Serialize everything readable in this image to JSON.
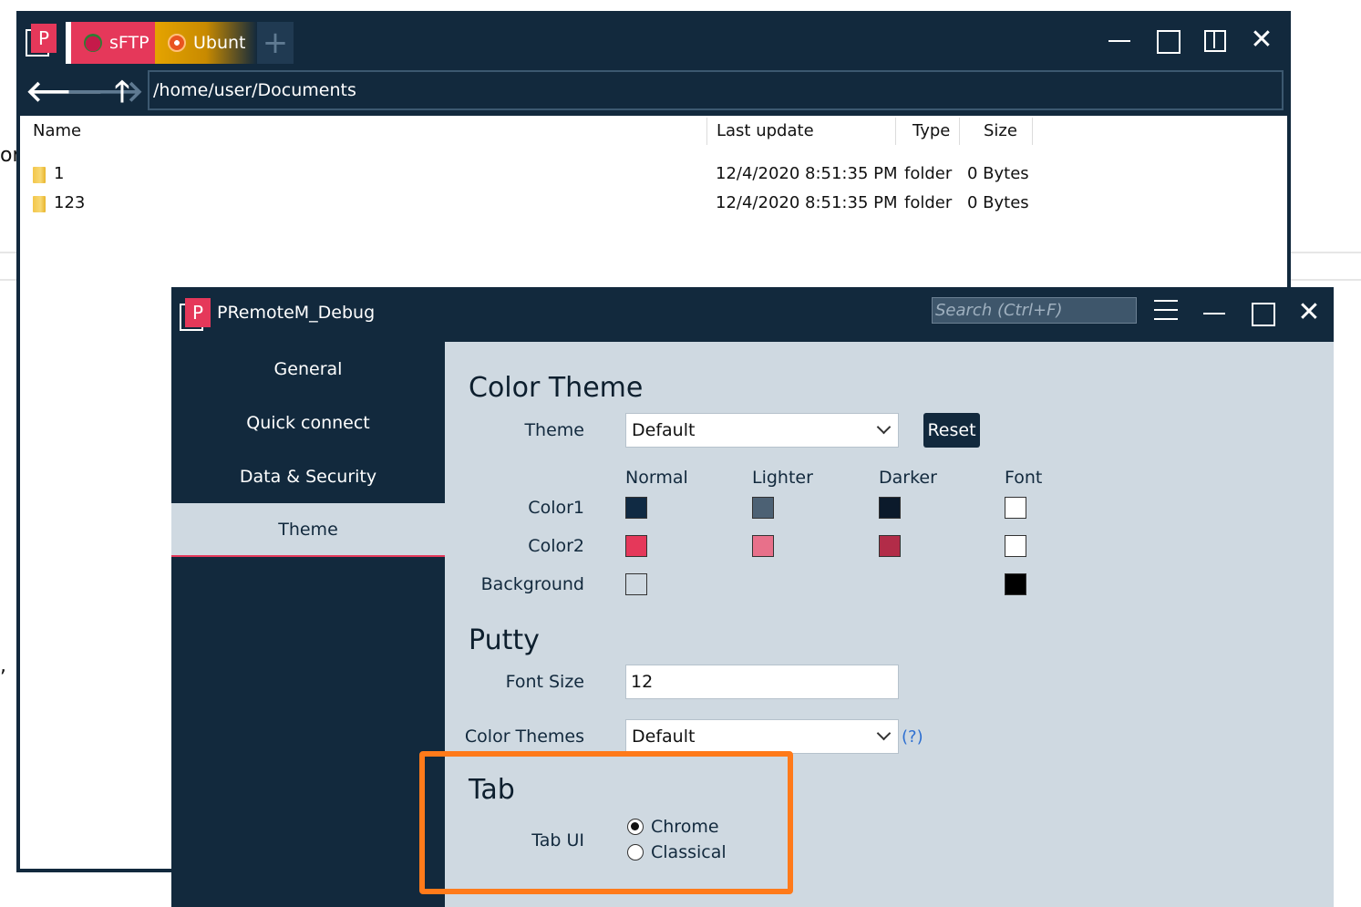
{
  "sftp_window": {
    "tabs": [
      {
        "label": "sFTP",
        "icon": "raspberry-pi-icon"
      },
      {
        "label": "Ubunt",
        "icon": "ubuntu-icon"
      }
    ],
    "path": "/home/user/Documents",
    "columns": {
      "name": "Name",
      "last_update": "Last update",
      "type": "Type",
      "size": "Size"
    },
    "files": [
      {
        "name": "1",
        "last_update": "12/4/2020 8:51:35 PM",
        "type": "folder",
        "size": "0 Bytes"
      },
      {
        "name": "123",
        "last_update": "12/4/2020 8:51:35 PM",
        "type": "folder",
        "size": "0 Bytes"
      }
    ]
  },
  "settings_window": {
    "title": "PRemoteM_Debug",
    "search_placeholder": "Search (Ctrl+F)",
    "nav": [
      {
        "label": "General",
        "selected": false
      },
      {
        "label": "Quick connect",
        "selected": false
      },
      {
        "label": "Data & Security",
        "selected": false
      },
      {
        "label": "Theme",
        "selected": true
      }
    ],
    "color_theme": {
      "title": "Color Theme",
      "theme_label": "Theme",
      "theme_value": "Default",
      "reset_label": "Reset",
      "columns": [
        "Normal",
        "Lighter",
        "Darker",
        "Font"
      ],
      "rows": [
        {
          "label": "Color1",
          "normal": "#102a43",
          "lighter": "#4c6174",
          "darker": "#0b1a2b",
          "font": "#ffffff"
        },
        {
          "label": "Color2",
          "normal": "#e5385a",
          "lighter": "#e8708a",
          "darker": "#b22c48",
          "font": "#ffffff"
        },
        {
          "label": "Background",
          "normal": "#cfd9e1",
          "font": "#000000"
        }
      ]
    },
    "putty": {
      "title": "Putty",
      "font_size_label": "Font Size",
      "font_size_value": "12",
      "color_themes_label": "Color Themes",
      "color_themes_value": "Default",
      "help_link": "(?)"
    },
    "tab": {
      "title": "Tab",
      "tab_ui_label": "Tab UI",
      "options": [
        {
          "label": "Chrome",
          "checked": true
        },
        {
          "label": "Classical",
          "checked": false
        }
      ]
    }
  },
  "colors": {
    "primary_dark": "#12293d",
    "accent": "#e5385a",
    "content_bg": "#cfd9e1",
    "highlight_border": "#ff7a1a"
  }
}
